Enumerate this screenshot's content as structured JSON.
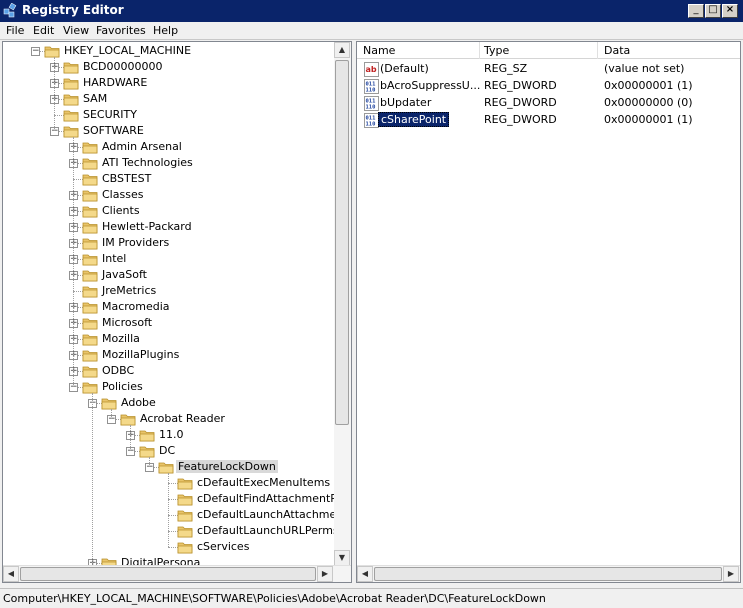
{
  "window": {
    "title": "Registry Editor"
  },
  "menu": [
    "File",
    "Edit",
    "View",
    "Favorites",
    "Help"
  ],
  "tree": [
    {
      "label": "HKEY_LOCAL_MACHINE",
      "level": 0,
      "exp": "-"
    },
    {
      "label": "BCD00000000",
      "level": 1,
      "exp": "+"
    },
    {
      "label": "HARDWARE",
      "level": 1,
      "exp": "+"
    },
    {
      "label": "SAM",
      "level": 1,
      "exp": "+"
    },
    {
      "label": "SECURITY",
      "level": 1,
      "exp": ""
    },
    {
      "label": "SOFTWARE",
      "level": 1,
      "exp": "-"
    },
    {
      "label": "Admin Arsenal",
      "level": 2,
      "exp": "+"
    },
    {
      "label": "ATI Technologies",
      "level": 2,
      "exp": "+"
    },
    {
      "label": "CBSTEST",
      "level": 2,
      "exp": ""
    },
    {
      "label": "Classes",
      "level": 2,
      "exp": "+"
    },
    {
      "label": "Clients",
      "level": 2,
      "exp": "+"
    },
    {
      "label": "Hewlett-Packard",
      "level": 2,
      "exp": "+"
    },
    {
      "label": "IM Providers",
      "level": 2,
      "exp": "+"
    },
    {
      "label": "Intel",
      "level": 2,
      "exp": "+"
    },
    {
      "label": "JavaSoft",
      "level": 2,
      "exp": "+"
    },
    {
      "label": "JreMetrics",
      "level": 2,
      "exp": ""
    },
    {
      "label": "Macromedia",
      "level": 2,
      "exp": "+"
    },
    {
      "label": "Microsoft",
      "level": 2,
      "exp": "+"
    },
    {
      "label": "Mozilla",
      "level": 2,
      "exp": "+"
    },
    {
      "label": "MozillaPlugins",
      "level": 2,
      "exp": "+"
    },
    {
      "label": "ODBC",
      "level": 2,
      "exp": "+"
    },
    {
      "label": "Policies",
      "level": 2,
      "exp": "-"
    },
    {
      "label": "Adobe",
      "level": 3,
      "exp": "-"
    },
    {
      "label": "Acrobat Reader",
      "level": 4,
      "exp": "-"
    },
    {
      "label": "11.0",
      "level": 5,
      "exp": "+"
    },
    {
      "label": "DC",
      "level": 5,
      "exp": "-"
    },
    {
      "label": "FeatureLockDown",
      "level": 6,
      "exp": "-",
      "selected": true
    },
    {
      "label": "cDefaultExecMenuItems",
      "level": 7,
      "exp": ""
    },
    {
      "label": "cDefaultFindAttachmentPerm",
      "level": 7,
      "exp": ""
    },
    {
      "label": "cDefaultLaunchAttachmentPe",
      "level": 7,
      "exp": ""
    },
    {
      "label": "cDefaultLaunchURLPerms",
      "level": 7,
      "exp": ""
    },
    {
      "label": "cServices",
      "level": 7,
      "exp": ""
    },
    {
      "label": "DigitalPersona",
      "level": 3,
      "exp": "+"
    }
  ],
  "list": {
    "headers": {
      "name": "Name",
      "type": "Type",
      "data": "Data"
    },
    "rows": [
      {
        "name": "(Default)",
        "type": "REG_SZ",
        "data": "(value not set)",
        "icon": "string-value-icon",
        "glyph": "ab"
      },
      {
        "name": "bAcroSuppressU...",
        "type": "REG_DWORD",
        "data": "0x00000001 (1)",
        "icon": "binary-value-icon",
        "glyph": "011"
      },
      {
        "name": "bUpdater",
        "type": "REG_DWORD",
        "data": "0x00000000 (0)",
        "icon": "binary-value-icon",
        "glyph": "011"
      },
      {
        "name": "cSharePoint",
        "type": "REG_DWORD",
        "data": "0x00000001 (1)",
        "icon": "binary-value-icon",
        "glyph": "011",
        "selected": true
      }
    ]
  },
  "status": "Computer\\HKEY_LOCAL_MACHINE\\SOFTWARE\\Policies\\Adobe\\Acrobat Reader\\DC\\FeatureLockDown",
  "colors": {
    "titlebar": "#0a246a",
    "selection": "#0a246a",
    "folder": "#e8c46a"
  }
}
